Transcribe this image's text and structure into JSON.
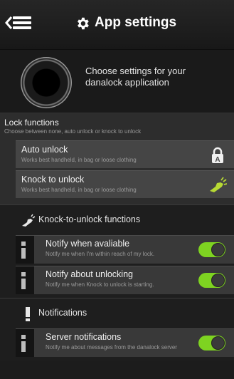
{
  "header": {
    "title": "App settings",
    "icons": [
      "back-arrow-icon",
      "menu-icon",
      "gear-icon"
    ]
  },
  "intro": {
    "text": "Choose settings for your danalock application",
    "logo": "danalock-logo"
  },
  "lock_functions": {
    "title": "Lock functions",
    "subtitle": "Choose between none, auto unlock or knock to unlock",
    "items": [
      {
        "label": "Auto unlock",
        "description": "Works best handheld, in bag or loose clothing",
        "icon": "auto-unlock-icon"
      },
      {
        "label": "Knock to unlock",
        "description": "Works best handheld, in bag or loose clothing",
        "icon": "knock-hand-icon"
      }
    ]
  },
  "knock_section": {
    "title": "Knock-to-unlock functions",
    "icon": "knock-hand-icon",
    "items": [
      {
        "label": "Notify when avaliable",
        "description": "Notify me when I'm within reach of my lock.",
        "enabled": true
      },
      {
        "label": "Notify about unlocking",
        "description": "Notify me when Knock to unlock is starting.",
        "enabled": true
      }
    ]
  },
  "notifications_section": {
    "title": "Notifications",
    "icon": "exclamation-icon",
    "items": [
      {
        "label": "Server notifications",
        "description": "Notify me about messages from the danalock server",
        "enabled": true
      }
    ]
  },
  "colors": {
    "toggle_on": "#7ed321",
    "background": "#1c1c1c",
    "header": "#262626"
  }
}
